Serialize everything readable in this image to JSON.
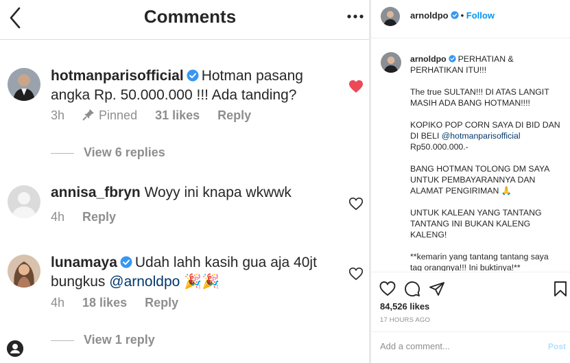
{
  "mobile": {
    "title": "Comments",
    "comments": [
      {
        "username": "hotmanparisofficial",
        "text": "Hotman pasang angka Rp. 50.000.000 !!! Ada tanding?",
        "time": "3h",
        "pinned": "Pinned",
        "likes": "31 likes",
        "reply": "Reply",
        "view_replies": "View 6 replies",
        "liked": true
      },
      {
        "username": "annisa_fbryn",
        "text": "Woyy ini knapa wkwwk",
        "time": "4h",
        "reply": "Reply"
      },
      {
        "username": "lunamaya",
        "text": "Udah lahh kasih gua aja 40jt bungkus",
        "mention": "@arnoldpo",
        "emoji": "🎉🎉",
        "time": "4h",
        "likes": "18 likes",
        "reply": "Reply",
        "view_replies": "View 1 reply"
      }
    ]
  },
  "post": {
    "username": "arnoldpo",
    "follow_label": "Follow",
    "separator": "•",
    "caption": {
      "lines": [
        "PERHATIAN & PERHATIKAN ITU!!!",
        "The true SULTAN!!! DI ATAS LANGIT MASIH ADA BANG HOTMAN!!!!",
        "KOPIKO POP CORN SAYA DI BID DAN DI BELI",
        "BANG HOTMAN TOLONG DM SAYA UNTUK PEMBAYARANNYA DAN ALAMAT PENGIRIMAN 🙏",
        "UNTUK KALEAN YANG TANTANG TANTANG INI BUKAN KALENG KALENG!",
        "**kemarin yang tantang tantang saya tag orangnya!!! Ini buktinya!**"
      ],
      "mention": "@hotmanparisofficial",
      "amount": "Rp50.000.000.-"
    },
    "likes": "84,526 likes",
    "time_ago": "17 HOURS AGO",
    "add_comment_placeholder": "Add a comment...",
    "post_label": "Post"
  },
  "colors": {
    "accent_blue": "#0095f6",
    "heart_red": "#ed4956",
    "muted": "#8e8e8e",
    "post_disabled": "#b2dffc"
  }
}
